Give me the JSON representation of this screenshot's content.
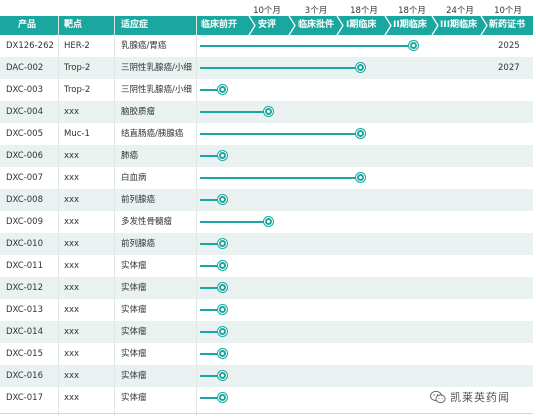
{
  "durations": [
    "10个月",
    "3个月",
    "18个月",
    "18个月",
    "24个月",
    "10个月"
  ],
  "headers": {
    "code": "产品",
    "target": "靶点",
    "indication": "适应症",
    "stages": [
      "临床前开",
      "安评",
      "临床批件",
      "I期临床",
      "II期临床",
      "III期临床",
      "新药证书"
    ]
  },
  "colors": {
    "accent": "#1aa7a0",
    "alt_row": "#e9f1f1"
  },
  "products": [
    {
      "code": "DX126-262",
      "target": "HER-2",
      "indication": "乳腺癌/胃癌",
      "progress": 0.88,
      "year": "2025"
    },
    {
      "code": "DAC-002",
      "target": "Trop-2",
      "indication": "三阴性乳腺癌/小细",
      "progress": 0.66,
      "year": "2027"
    },
    {
      "code": "DXC-003",
      "target": "Trop-2",
      "indication": "三阴性乳腺癌/小细",
      "progress": 0.09,
      "year": ""
    },
    {
      "code": "DXC-004",
      "target": "xxx",
      "indication": "脑胶质瘤",
      "progress": 0.28,
      "year": ""
    },
    {
      "code": "DXC-005",
      "target": "Muc-1",
      "indication": "结直肠癌/胰腺癌",
      "progress": 0.66,
      "year": ""
    },
    {
      "code": "DXC-006",
      "target": "xxx",
      "indication": "肺癌",
      "progress": 0.09,
      "year": ""
    },
    {
      "code": "DXC-007",
      "target": "xxx",
      "indication": "白血病",
      "progress": 0.66,
      "year": ""
    },
    {
      "code": "DXC-008",
      "target": "xxx",
      "indication": "前列腺癌",
      "progress": 0.09,
      "year": ""
    },
    {
      "code": "DXC-009",
      "target": "xxx",
      "indication": "多发性骨髓瘤",
      "progress": 0.28,
      "year": ""
    },
    {
      "code": "DXC-010",
      "target": "xxx",
      "indication": "前列腺癌",
      "progress": 0.09,
      "year": ""
    },
    {
      "code": "DXC-011",
      "target": "xxx",
      "indication": "实体瘤",
      "progress": 0.09,
      "year": ""
    },
    {
      "code": "DXC-012",
      "target": "xxx",
      "indication": "实体瘤",
      "progress": 0.09,
      "year": ""
    },
    {
      "code": "DXC-013",
      "target": "xxx",
      "indication": "实体瘤",
      "progress": 0.09,
      "year": ""
    },
    {
      "code": "DXC-014",
      "target": "xxx",
      "indication": "实体瘤",
      "progress": 0.09,
      "year": ""
    },
    {
      "code": "DXC-015",
      "target": "xxx",
      "indication": "实体瘤",
      "progress": 0.09,
      "year": ""
    },
    {
      "code": "DXC-016",
      "target": "xxx",
      "indication": "实体瘤",
      "progress": 0.09,
      "year": ""
    },
    {
      "code": "DXC-017",
      "target": "xxx",
      "indication": "实体瘤",
      "progress": 0.09,
      "year": ""
    }
  ],
  "watermark": {
    "text": "凯莱英药闻",
    "icon": "wechat-icon"
  }
}
